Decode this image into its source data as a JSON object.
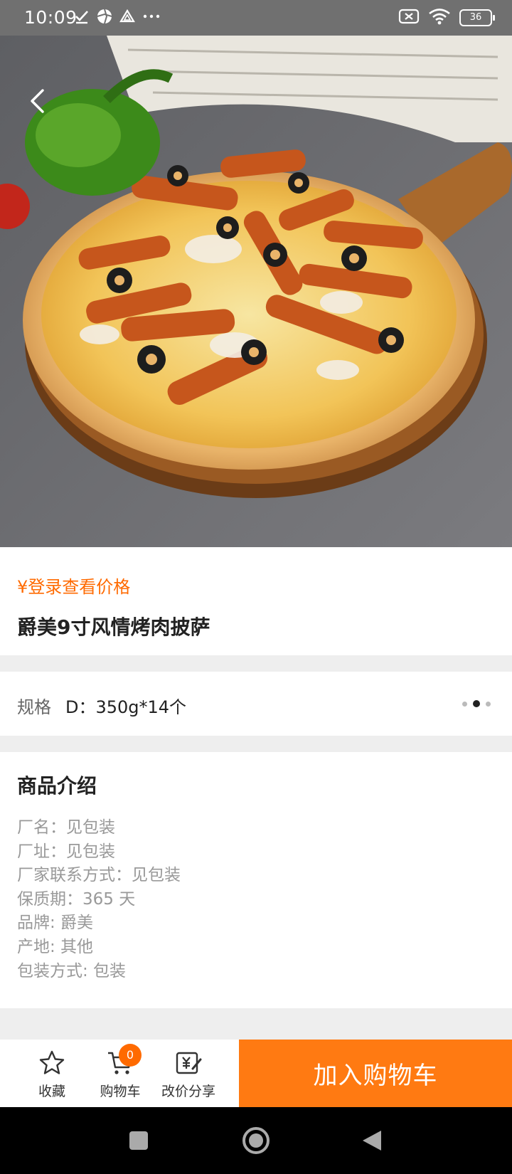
{
  "status_bar": {
    "time": "10:09",
    "battery": "36",
    "icons": [
      "check-download-icon",
      "app-icon",
      "drive-icon",
      "more-dots-icon",
      "no-sim-icon",
      "wifi-icon",
      "battery-icon"
    ]
  },
  "product": {
    "price": "¥登录查看价格",
    "title": "爵美9寸风情烤肉披萨"
  },
  "spec": {
    "label": "规格",
    "value": "D：350g*14个"
  },
  "description": {
    "title": "商品介绍",
    "lines": [
      "厂名：见包装",
      "厂址：见包装",
      "厂家联系方式：见包装",
      "保质期：365 天",
      "品牌: 爵美",
      "产地: 其他",
      "包装方式: 包装"
    ]
  },
  "action_bar": {
    "favorite": "收藏",
    "cart": "购物车",
    "cart_count": "0",
    "share": "改价分享",
    "add_to_cart": "加入购物车"
  },
  "colors": {
    "accent": "#ff7a12",
    "price": "#ff6a00",
    "status_bar": "#707070"
  }
}
